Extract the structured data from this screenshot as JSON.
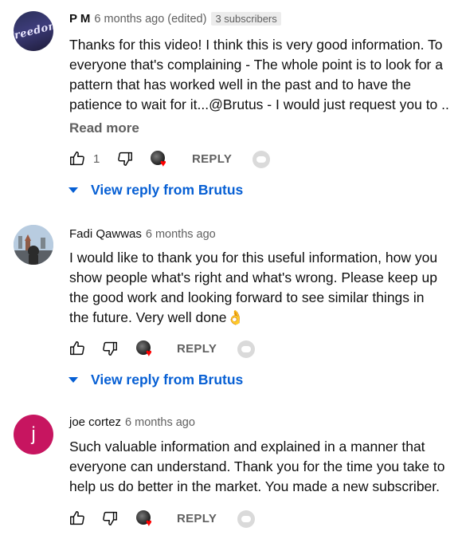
{
  "comments": [
    {
      "author": "P M",
      "time": "6 months ago",
      "edited": "(edited)",
      "subscribers": "3 subscribers",
      "avatar_text": "Freedom",
      "lines": [
        "Thanks for this video! I think this is very good information. To",
        "everyone that's complaining - The whole point is to look for a",
        "pattern that has worked well in the past and to have the",
        "patience to wait for it...@Brutus - I would just request you to ..."
      ],
      "read_more": "Read more",
      "like_count": "1",
      "reply_label": "REPLY",
      "view_replies": "View reply from Brutus"
    },
    {
      "author": "Fadi Qawwas",
      "time": "6 months ago",
      "lines": [
        "I would like to thank you for this useful information, how you",
        "show people what's right and what's wrong. Please keep up",
        "the good work and looking forward to see similar things in",
        "the future. Very well done"
      ],
      "emoji": "👌",
      "reply_label": "REPLY",
      "view_replies": "View reply from Brutus"
    },
    {
      "author": "joe cortez",
      "time": "6 months ago",
      "avatar_letter": "j",
      "lines": [
        "Such valuable information and explained in a manner that",
        "everyone can understand. Thank you for the time you take to",
        "help us do better in the market. You made a new subscriber."
      ],
      "reply_label": "REPLY"
    }
  ],
  "icons": {
    "like": "thumbs-up-icon",
    "dislike": "thumbs-down-icon",
    "creator_heart": "creator-heart-icon",
    "thanks": "thanks-pill-icon",
    "expand": "caret-down-icon"
  },
  "colors": {
    "link_blue": "#065fd4",
    "heart_red": "#ff0000",
    "avatar_pink": "#c71560"
  }
}
